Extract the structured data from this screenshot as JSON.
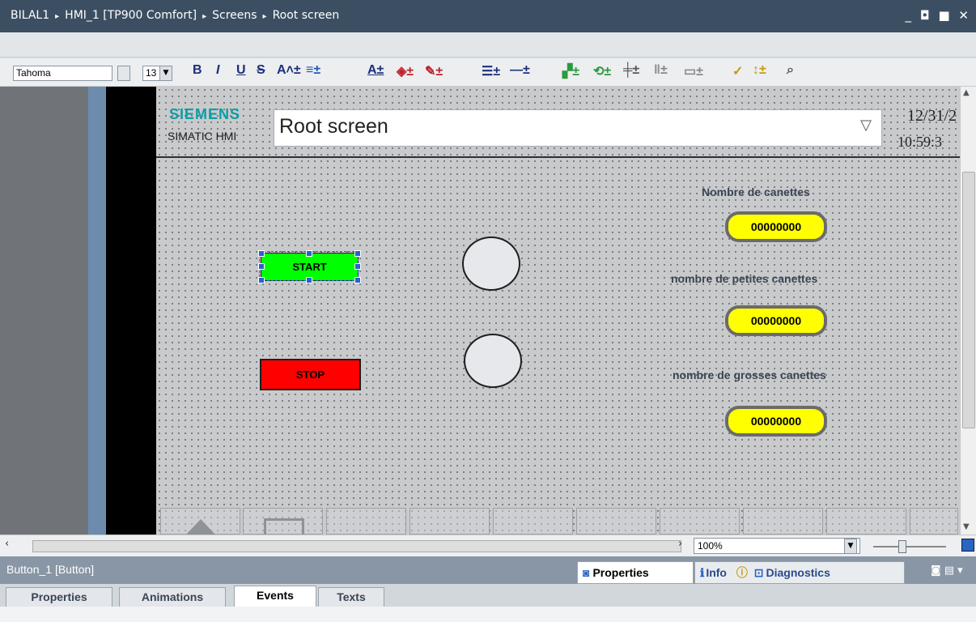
{
  "titlebar": {
    "crumbs": [
      "BILAL1",
      "HMI_1 [TP900 Comfort]",
      "Screens",
      "Root screen"
    ],
    "sep": "▸",
    "window_controls": "_ ▣ ▤ ✕"
  },
  "toolbar": {
    "font_name": "Tahoma",
    "font_size": "13",
    "bold": "B",
    "italic": "I",
    "underline": "U",
    "strike": "S"
  },
  "hmi": {
    "brand": "SIEMENS",
    "subbrand": "SIMATIC HMI",
    "screen_selector": "Root screen",
    "date": "12/31/2",
    "time": "10:59:3",
    "start_label": "START",
    "stop_label": "STOP",
    "labels": {
      "cans": "Nombre de canettes",
      "small": "nombre de petites canettes",
      "large": "nombre de grosses canettes"
    },
    "io_values": {
      "cans": "00000000",
      "small": "00000000",
      "large": "00000000"
    }
  },
  "status": {
    "zoom": "100%"
  },
  "properties": {
    "object_name": "Button_1 [Button]",
    "top_tabs": [
      "Properties",
      "Info",
      "Diagnostics"
    ],
    "tabs": [
      "Properties",
      "Animations",
      "Events",
      "Texts"
    ]
  },
  "colors": {
    "start_green": "#00ff00",
    "stop_red": "#ff0000",
    "io_yellow": "#ffff00",
    "title_bar": "#3c4f62",
    "siemens_teal": "#0a9ea6"
  },
  "icons": {
    "window_controls": [
      "minimize-icon",
      "restore-icon",
      "tile-icon",
      "close-icon"
    ],
    "dropdown": "chevron-down-icon"
  }
}
